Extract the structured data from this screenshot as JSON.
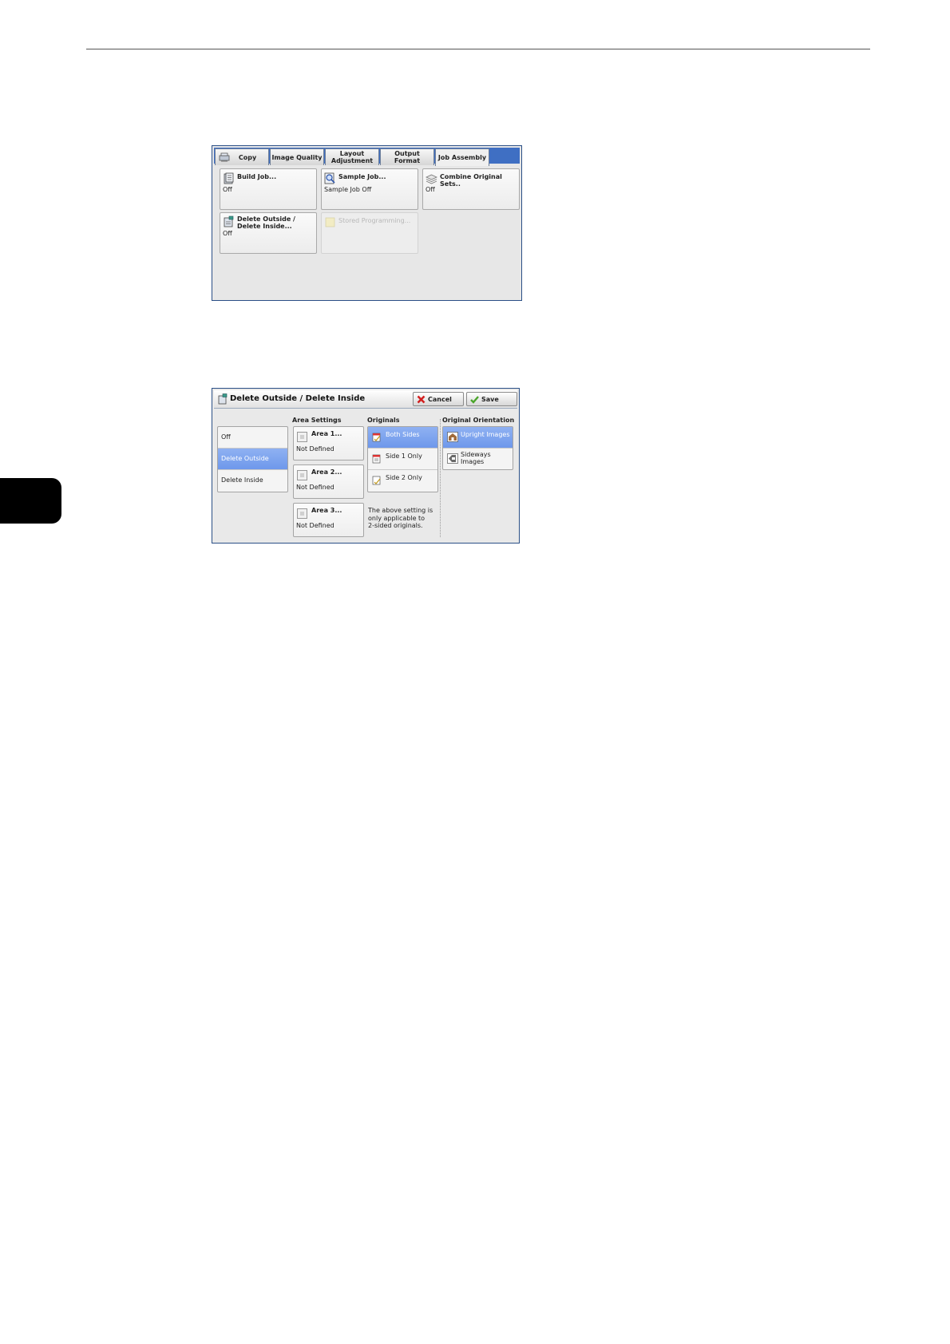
{
  "copy_screen": {
    "tabs": [
      "Copy",
      "Image Quality",
      "Layout\nAdjustment",
      "Output Format",
      "Job Assembly"
    ],
    "active_tab": "Job Assembly",
    "cards": [
      {
        "title": "Build Job...",
        "value": "Off"
      },
      {
        "title": "Sample Job...",
        "value": "Sample Job Off"
      },
      {
        "title": "Combine Original Sets..",
        "value": "Off"
      },
      {
        "title": "Delete Outside /\nDelete Inside...",
        "value": "Off"
      },
      {
        "title": "Stored Programming...",
        "value": ""
      }
    ]
  },
  "delete_screen": {
    "title": "Delete Outside / Delete Inside",
    "cancel_label": "Cancel",
    "save_label": "Save",
    "mode_options": [
      "Off",
      "Delete Outside",
      "Delete Inside"
    ],
    "selected_mode": "Delete Outside",
    "area_settings": {
      "heading": "Area Settings",
      "areas": [
        {
          "title": "Area 1...",
          "value": "Not Defined"
        },
        {
          "title": "Area 2...",
          "value": "Not Defined"
        },
        {
          "title": "Area 3...",
          "value": "Not Defined"
        }
      ]
    },
    "originals": {
      "heading": "Originals",
      "options": [
        "Both Sides",
        "Side 1 Only",
        "Side 2 Only"
      ],
      "selected": "Both Sides",
      "note": "The above setting is\nonly applicable to\n2-sided originals."
    },
    "orientation": {
      "heading": "Original Orientation",
      "options": [
        "Upright Images",
        "Sideways\nImages"
      ],
      "selected": "Upright Images"
    }
  }
}
